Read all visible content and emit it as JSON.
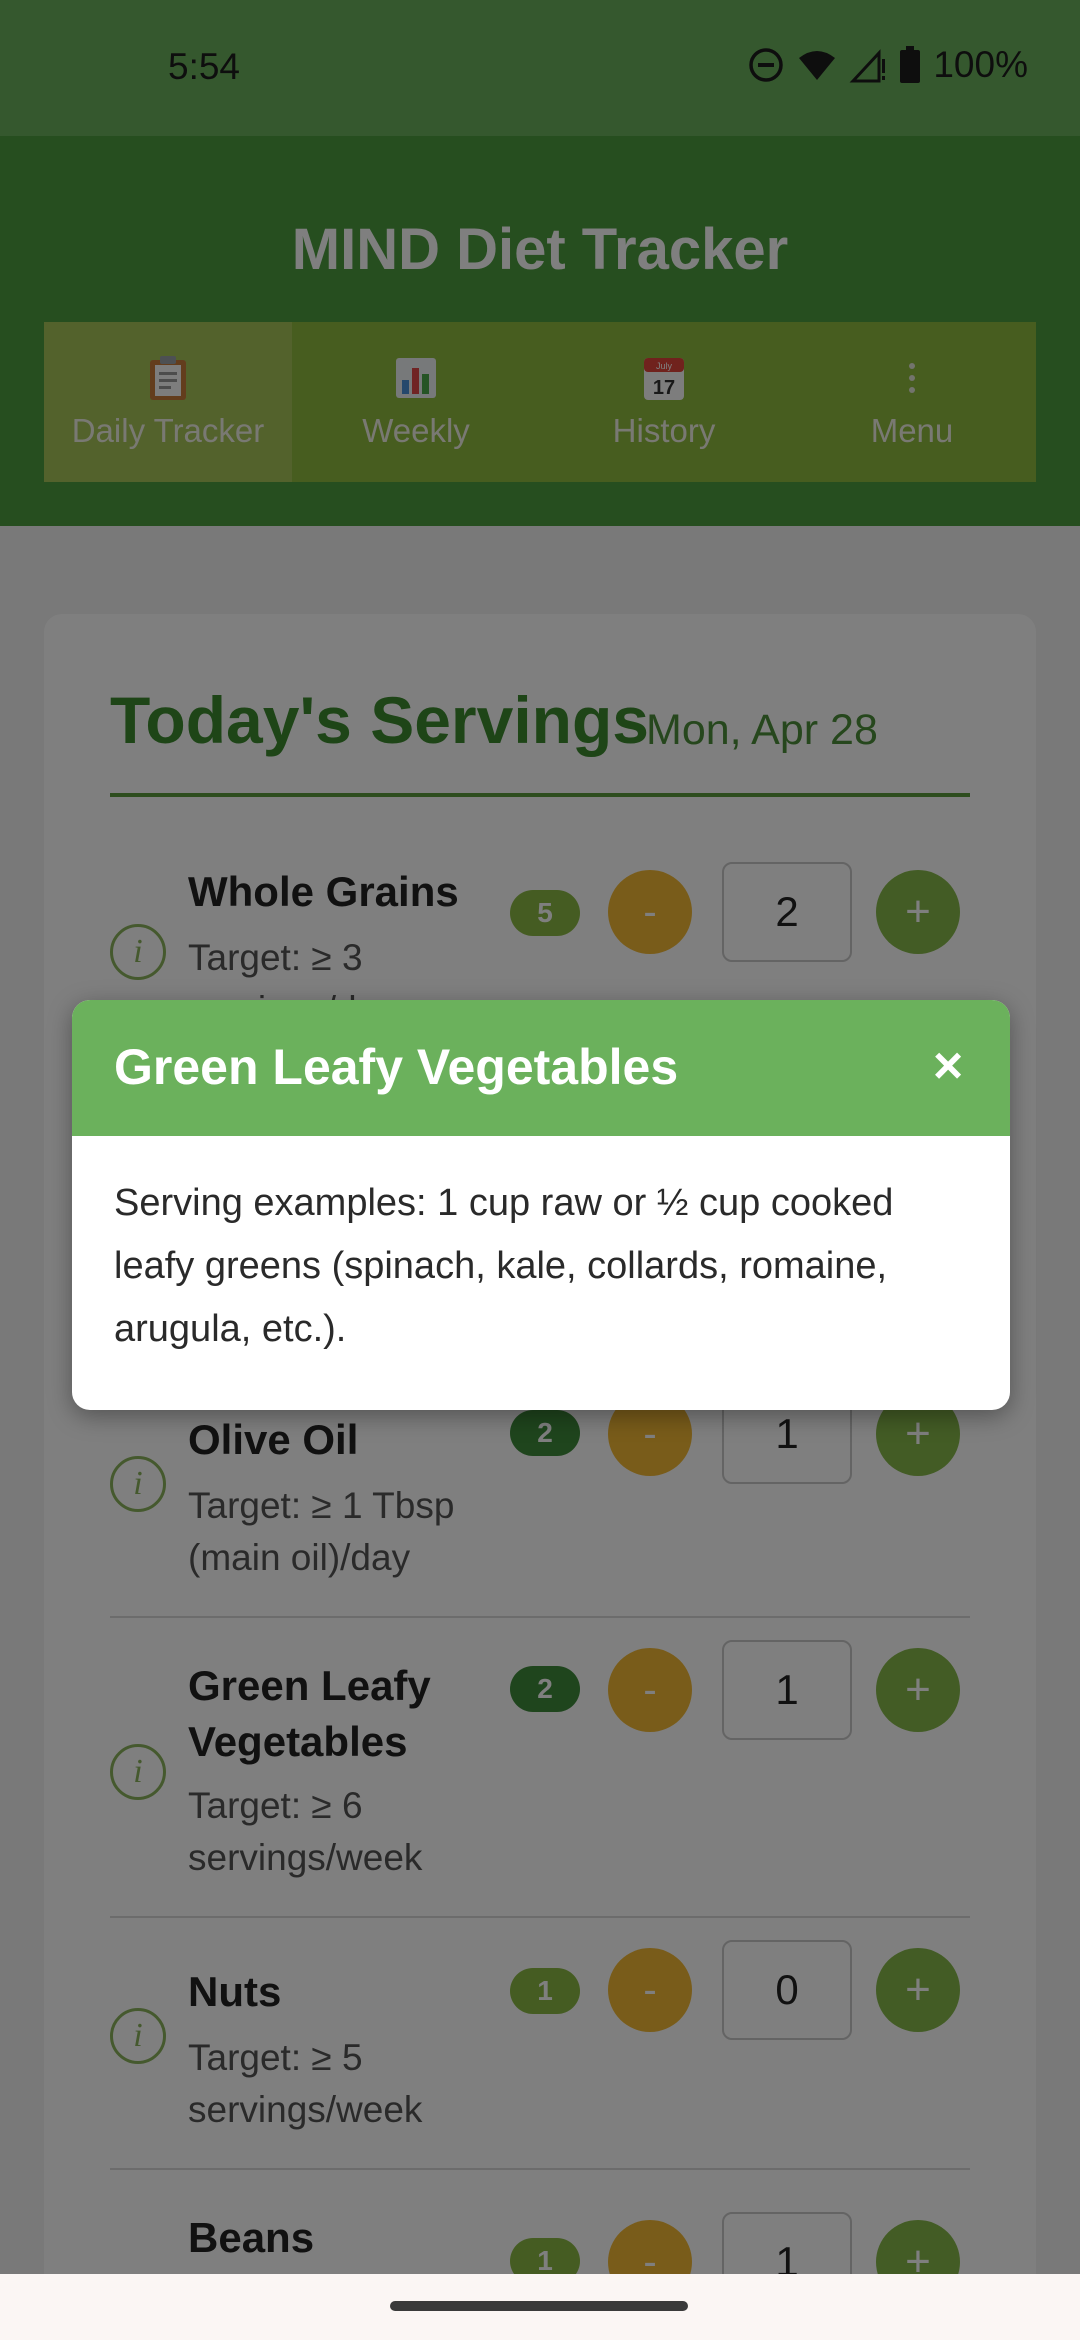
{
  "status_bar": {
    "time": "5:54",
    "battery": "100%"
  },
  "header": {
    "title": "MIND Diet Tracker"
  },
  "tabs": [
    {
      "label": "Daily Tracker",
      "icon": "clipboard-icon"
    },
    {
      "label": "Weekly",
      "icon": "bar-chart-icon"
    },
    {
      "label": "History",
      "icon": "calendar-icon",
      "icon_text": {
        "month": "July",
        "day": "17"
      }
    },
    {
      "label": "Menu",
      "icon": "more-vert-icon"
    }
  ],
  "card": {
    "title": "Today's Servings",
    "date": "Mon, Apr 28"
  },
  "foods": [
    {
      "name": "Whole Grains",
      "target": "Target: ≥ 3 servings/day",
      "badge": "5",
      "count": "2"
    },
    {
      "name": "Olive Oil",
      "target": "Target: ≥ 1 Tbsp (main oil)/day",
      "badge": "2",
      "count": "1"
    },
    {
      "name": "Green Leafy Vegetables",
      "target": "Target: ≥ 6 servings/week",
      "badge": "2",
      "count": "1"
    },
    {
      "name": "Nuts",
      "target": "Target: ≥ 5 servings/week",
      "badge": "1",
      "count": "0"
    },
    {
      "name": "Beans",
      "target": "",
      "badge": "1",
      "count": "1"
    }
  ],
  "buttons": {
    "minus": "-",
    "plus": "+",
    "info": "i"
  },
  "modal": {
    "title": "Green Leafy Vegetables",
    "close": "×",
    "body": "Serving examples: 1 cup raw or ½ cup cooked leafy greens (spinach, kale, collards, romaine, arugula, etc.)."
  }
}
